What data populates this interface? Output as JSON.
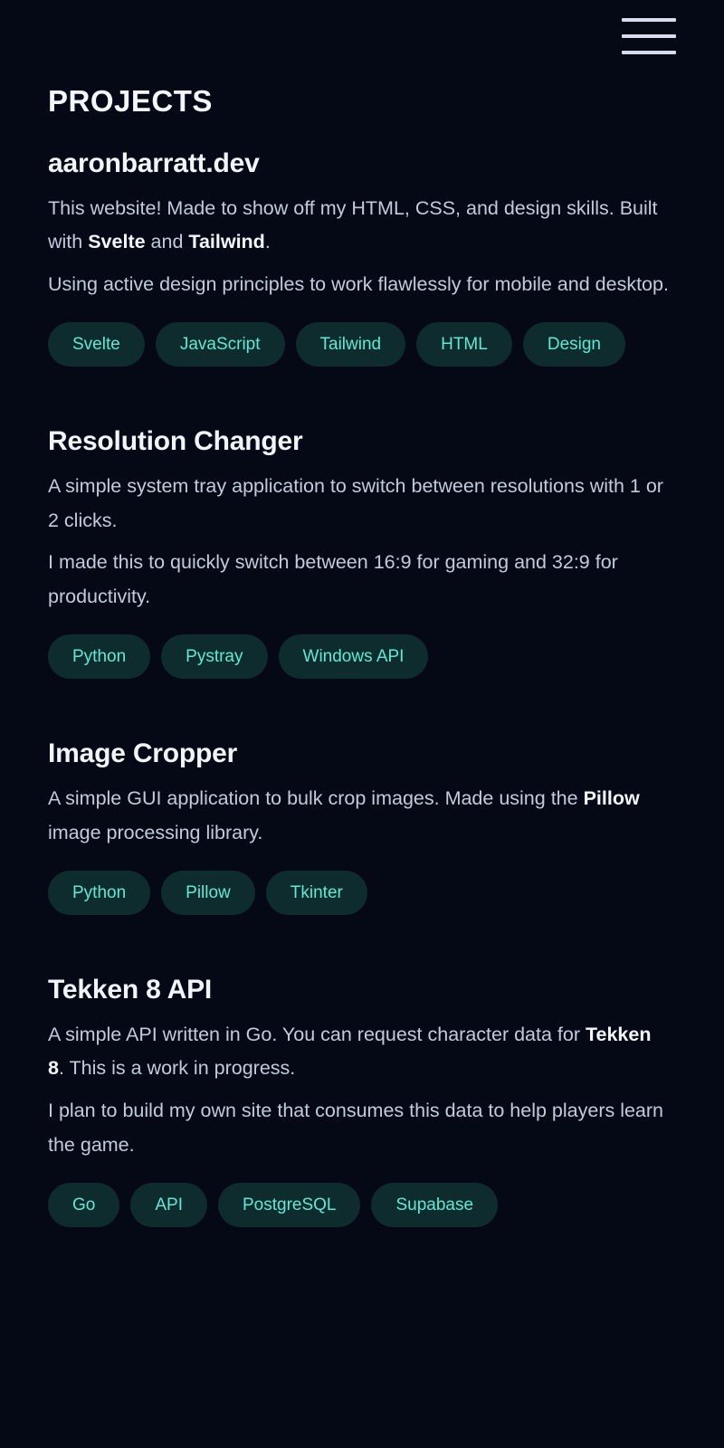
{
  "page": {
    "background_color": "#050916",
    "accent_color": "#5eead4",
    "tag_background_color": "#0e2b2e",
    "heading_color": "#f1f5f9",
    "body_text_color": "#c3cbda"
  },
  "nav": {
    "menu_button_label": "Menu",
    "icon": "hamburger-menu-icon"
  },
  "section": {
    "title": "PROJECTS"
  },
  "projects": [
    {
      "title": "aaronbarratt.dev",
      "paragraphs": [
        [
          {
            "text": "This website! Made to show off my HTML, CSS, and design skills. Built with ",
            "highlight": false
          },
          {
            "text": "Svelte",
            "highlight": true
          },
          {
            "text": " and ",
            "highlight": false
          },
          {
            "text": "Tailwind",
            "highlight": true
          },
          {
            "text": ".",
            "highlight": false
          }
        ],
        [
          {
            "text": "Using active design principles to work flawlessly for mobile and desktop.",
            "highlight": false
          }
        ]
      ],
      "tags": [
        "Svelte",
        "JavaScript",
        "Tailwind",
        "HTML",
        "Design"
      ]
    },
    {
      "title": "Resolution Changer",
      "paragraphs": [
        [
          {
            "text": "A simple system tray application to switch between resolutions with 1 or 2 clicks.",
            "highlight": false
          }
        ],
        [
          {
            "text": "I made this to quickly switch between 16:9 for gaming and 32:9 for productivity.",
            "highlight": false
          }
        ]
      ],
      "tags": [
        "Python",
        "Pystray",
        "Windows API"
      ]
    },
    {
      "title": "Image Cropper",
      "paragraphs": [
        [
          {
            "text": "A simple GUI application to bulk crop images. Made using the ",
            "highlight": false
          },
          {
            "text": "Pillow",
            "highlight": true
          },
          {
            "text": " image processing library.",
            "highlight": false
          }
        ]
      ],
      "tags": [
        "Python",
        "Pillow",
        "Tkinter"
      ]
    },
    {
      "title": "Tekken 8 API",
      "paragraphs": [
        [
          {
            "text": "A simple API written in Go. You can request character data for ",
            "highlight": false
          },
          {
            "text": "Tekken 8",
            "highlight": true
          },
          {
            "text": ". This is a work in progress.",
            "highlight": false
          }
        ],
        [
          {
            "text": "I plan to build my own site that consumes this data to help players learn the game.",
            "highlight": false
          }
        ]
      ],
      "tags": [
        "Go",
        "API",
        "PostgreSQL",
        "Supabase"
      ]
    }
  ]
}
